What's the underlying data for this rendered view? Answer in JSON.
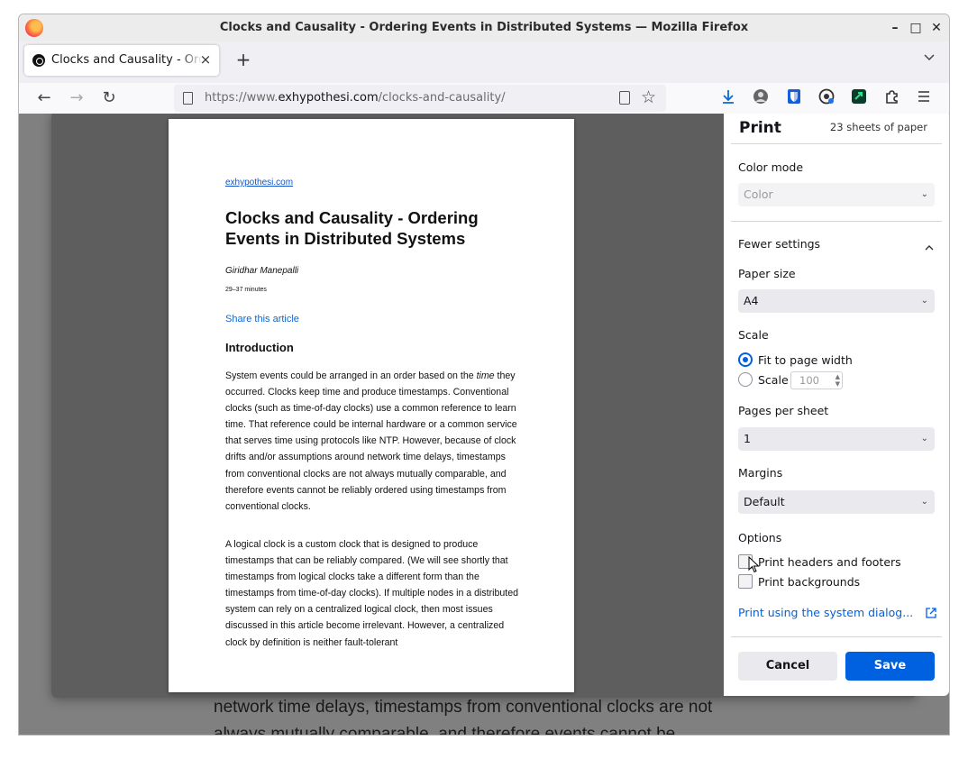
{
  "window": {
    "title": "Clocks and Causality - Ordering Events in Distributed Systems — Mozilla Firefox",
    "controls": {
      "minimize": "–",
      "maximize": "□",
      "close": "✕"
    }
  },
  "tab": {
    "label": "Clocks and Causality - Ordering Events in Distributed Systems",
    "close": "×",
    "new_tab": "+",
    "list": "⌄"
  },
  "navbar": {
    "back": "←",
    "forward": "→",
    "reload": "↻",
    "url_prefix": "https://www.",
    "url_domain": "exhypothesi.com",
    "url_path": "/clocks-and-causality/",
    "star": "☆"
  },
  "toolbar_icons": [
    "download-icon",
    "account-icon",
    "bitwarden-icon",
    "extension-icon-a",
    "extension-icon-b",
    "extensions-icon",
    "menu-icon"
  ],
  "preview": {
    "site": "exhypothesi.com",
    "title": "Clocks and Causality - Ordering Events in Distributed Systems",
    "author": "Giridhar Manepalli",
    "read_time": "29–37 minutes",
    "share": "Share this article",
    "heading": "Introduction",
    "para1_start": "System events could be arranged in an order based on the ",
    "para1_em": "time",
    "para1_rest": " they occurred. Clocks keep time and produce timestamps. Conventional clocks (such as time-of-day clocks) use a common reference to learn time. That reference could be internal hardware or a common service that serves time using protocols like NTP. However, because of clock drifts and/or assumptions around network time delays, timestamps from conventional clocks are not always mutually comparable, and therefore events cannot be reliably ordered using timestamps from conventional clocks.",
    "para2": "A logical clock is a custom clock that is designed to produce timestamps that can be reliably compared. (We will see shortly that timestamps from logical clocks take a different form than the timestamps from time-of-day clocks). If multiple nodes in a distributed system can rely on a centralized logical clock, then most issues discussed in this article become irrelevant. However, a centralized clock by definition is neither fault-tolerant"
  },
  "background_text": {
    "line1": "network time delays, timestamps from conventional clocks are not",
    "line2": "always mutually comparable, and therefore events cannot be"
  },
  "print": {
    "title": "Print",
    "sheets": "23 sheets of paper",
    "color_mode_label": "Color mode",
    "color_mode_value": "Color",
    "fewer_settings": "Fewer settings",
    "paper_size_label": "Paper size",
    "paper_size_value": "A4",
    "scale_label": "Scale",
    "fit_to_width": "Fit to page width",
    "scale_option": "Scale",
    "scale_value": "100",
    "pages_per_sheet_label": "Pages per sheet",
    "pages_per_sheet_value": "1",
    "margins_label": "Margins",
    "margins_value": "Default",
    "options_label": "Options",
    "headers_footers": "Print headers and footers",
    "backgrounds": "Print backgrounds",
    "system_dialog": "Print using the system dialog...",
    "cancel": "Cancel",
    "save": "Save"
  },
  "colors": {
    "accent": "#0061e0",
    "link": "#1155cc",
    "backdrop": "#808080"
  }
}
